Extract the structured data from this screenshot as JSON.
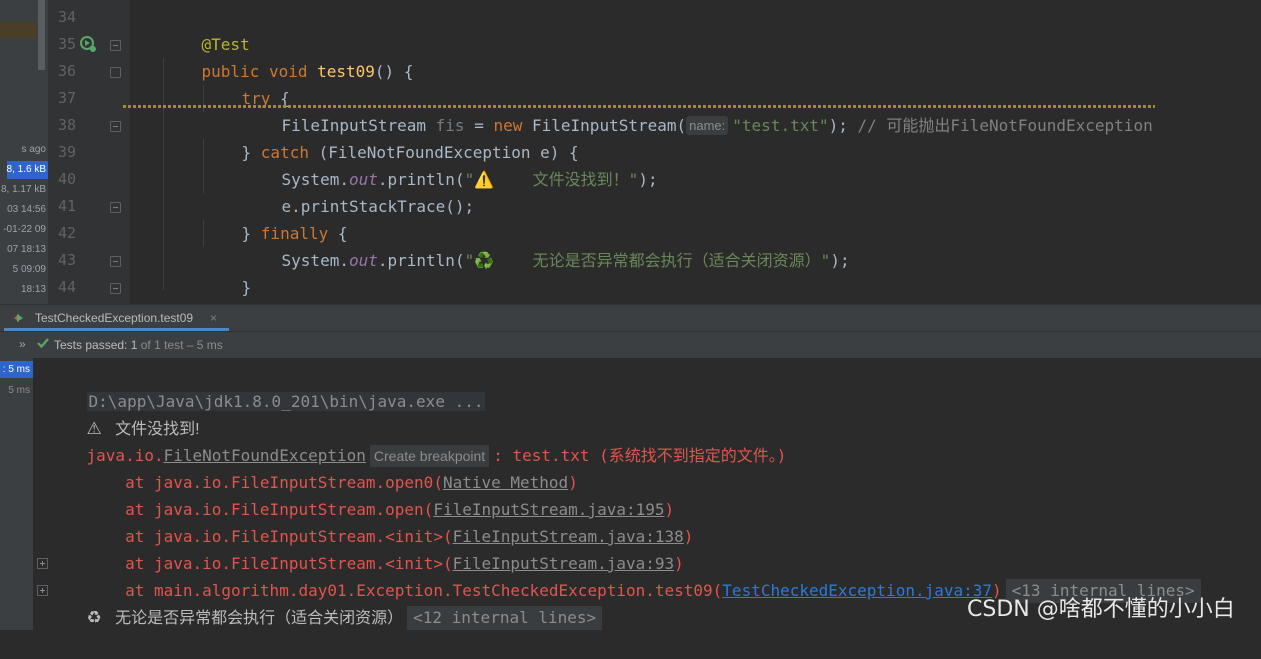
{
  "left_strip": {
    "rows": [
      "s ago",
      "8, 1.6 kB",
      "8, 1.17 kB",
      "03 14:56",
      "-01-22 09",
      "07 18:13",
      "5 09:09",
      "18:13"
    ]
  },
  "editor": {
    "line_numbers": [
      "34",
      "35",
      "36",
      "37",
      "38",
      "39",
      "40",
      "41",
      "42",
      "43",
      "44"
    ],
    "annotation": "@Test",
    "method_kw": "public void ",
    "method_name": "test09",
    "method_tail": "() {",
    "try_kw": "try",
    "try_brace": " {",
    "decl_type": "FileInputStream ",
    "decl_var": "fis",
    "decl_eq": " = ",
    "new_kw": "new",
    "ctor_name": " FileInputStream(",
    "param_hint": "name:",
    "file_literal": "\"test.txt\"",
    "stmt_end": "); ",
    "comment": "// 可能抛出FileNotFoundException",
    "catch_close": "} ",
    "catch_kw": "catch",
    "catch_tail": " (FileNotFoundException e) {",
    "sys_prefix": "System.",
    "sys_out": "out",
    "println_open": ".println(",
    "msg_not_found": "\"⚠️    文件没找到！\"",
    "println_close": ");",
    "print_stack": "e.printStackTrace();",
    "finally_close": "} ",
    "finally_kw": "finally",
    "finally_brace": " {",
    "msg_finally": "\"♻️    无论是否异常都会执行（适合关闭资源）\"",
    "inner_close": "}",
    "outer_close": "}"
  },
  "run_panel": {
    "tab_label": "TestCheckedException.test09",
    "tab_close": "×",
    "expand_glyph": "»",
    "tests_passed_label": "Tests passed: ",
    "tests_passed_count": "1",
    "tests_rest": " of 1 test – 5 ms",
    "tree_selected": ": 5 ms",
    "tree_second": "5 ms"
  },
  "console": {
    "command": "D:\\app\\Java\\jdk1.8.0_201\\bin\\java.exe ...",
    "warn_glyph": "⚠",
    "out_not_found": "   文件没找到!",
    "exc_prefix": "java.io.",
    "exc_name": "FileNotFoundException",
    "create_breakpoint": "Create breakpoint",
    "exc_message": ": test.txt (系统找不到指定的文件。)",
    "frame1_prefix": "    at java.io.FileInputStream.open0(",
    "frame1_link": "Native Method",
    "frame2_prefix": "    at java.io.FileInputStream.open(",
    "frame2_link": "FileInputStream.java:195",
    "frame3_prefix": "    at java.io.FileInputStream.<init>(",
    "frame3_link": "FileInputStream.java:138",
    "frame4_prefix": "    at java.io.FileInputStream.<init>(",
    "frame4_link": "FileInputStream.java:93",
    "frame5_prefix": "    at main.algorithm.day01.Exception.TestCheckedException.test09(",
    "frame5_link": "TestCheckedException.java:37",
    "close_paren": ")",
    "internal_13": "<13 internal lines>",
    "recycle_glyph": "♻",
    "out_finally": "   无论是否异常都会执行（适合关闭资源）",
    "internal_12": "<12 internal lines>"
  },
  "watermark": "CSDN @啥都不懂的小小白",
  "colors": {
    "editor_bg": "#2b2b2b",
    "keyword": "#cc7832",
    "annotation": "#bbb529",
    "method": "#ffc66d",
    "string": "#6a8759",
    "error": "#e0554d",
    "link": "#287bde",
    "selection": "#2f65ca",
    "tab_underline": "#4a88c7"
  }
}
